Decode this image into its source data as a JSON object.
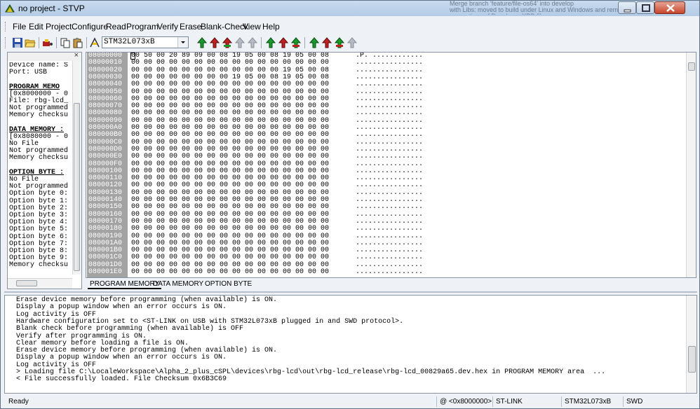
{
  "window": {
    "title": "no project - STVP",
    "background_windows": [
      "Merge branch 'feature/file-os64' into develop",
      "with Libs: moved to build under Linux and Windows and remove generations of Developer XBD files"
    ]
  },
  "menu": [
    "File",
    "Edit",
    "Project",
    "Configure",
    "Read",
    "Program",
    "Verify",
    "Erase",
    "Blank-Check",
    "View",
    "Help"
  ],
  "toolbar": {
    "device": "STM32L073xB",
    "icons": [
      "save-icon",
      "open-folder-icon",
      "connect-icon",
      "copy-icon",
      "paste-icon",
      "ladder-icon",
      "read-all-icon",
      "read-current-icon",
      "read-icon",
      "read-disabled-icon",
      "read-disabled-icon",
      "program-all-icon",
      "program-current-icon",
      "program-icon",
      "verify-all-icon",
      "verify-current-icon",
      "verify-icon",
      "verify-disabled-icon"
    ]
  },
  "info_panel": {
    "lines": [
      {
        "text": "Device name: S",
        "header": false
      },
      {
        "text": "Port: USB",
        "header": false
      },
      {
        "text": "",
        "header": false
      },
      {
        "text": "PROGRAM MEMO",
        "header": true
      },
      {
        "text": "[0x8000000 - 0",
        "header": false
      },
      {
        "text": "File: rbg-lcd_",
        "header": false
      },
      {
        "text": "Not programmed",
        "header": false
      },
      {
        "text": "Memory checksu",
        "header": false
      },
      {
        "text": "",
        "header": false
      },
      {
        "text": "DATA MEMORY :",
        "header": true
      },
      {
        "text": "[0x8080000 - 0",
        "header": false
      },
      {
        "text": "No File",
        "header": false
      },
      {
        "text": "Not programmed",
        "header": false
      },
      {
        "text": "Memory checksu",
        "header": false
      },
      {
        "text": "",
        "header": false
      },
      {
        "text": "OPTION BYTE :",
        "header": true
      },
      {
        "text": "No File",
        "header": false
      },
      {
        "text": "Not programmed",
        "header": false
      },
      {
        "text": "Option byte 0:",
        "header": false
      },
      {
        "text": "Option byte 1:",
        "header": false
      },
      {
        "text": "Option byte 2:",
        "header": false
      },
      {
        "text": "Option byte 3:",
        "header": false
      },
      {
        "text": "Option byte 4:",
        "header": false
      },
      {
        "text": "Option byte 5:",
        "header": false
      },
      {
        "text": "Option byte 6:",
        "header": false
      },
      {
        "text": "Option byte 7:",
        "header": false
      },
      {
        "text": "Option byte 8:",
        "header": false
      },
      {
        "text": "Option byte 9:",
        "header": false
      },
      {
        "text": "Memory checksu",
        "header": false
      }
    ]
  },
  "hex": {
    "rows": [
      {
        "addr": "08000000",
        "bytes": "00 50 00 20 89 09 00 08 19 05 00 08 19 05 00 08",
        "ascii": ".P. ............"
      },
      {
        "addr": "08000010",
        "bytes": "00 00 00 00 00 00 00 00 00 00 00 00 00 00 00 00",
        "ascii": "................"
      },
      {
        "addr": "08000020",
        "bytes": "00 00 00 00 00 00 00 00 00 00 00 00 19 05 00 08",
        "ascii": "................"
      },
      {
        "addr": "08000030",
        "bytes": "00 00 00 00 00 00 00 00 19 05 00 08 19 05 00 08",
        "ascii": "................"
      },
      {
        "addr": "08000040",
        "bytes": "00 00 00 00 00 00 00 00 00 00 00 00 00 00 00 00",
        "ascii": "................"
      },
      {
        "addr": "08000050",
        "bytes": "00 00 00 00 00 00 00 00 00 00 00 00 00 00 00 00",
        "ascii": "................"
      },
      {
        "addr": "08000060",
        "bytes": "00 00 00 00 00 00 00 00 00 00 00 00 00 00 00 00",
        "ascii": "................"
      },
      {
        "addr": "08000070",
        "bytes": "00 00 00 00 00 00 00 00 00 00 00 00 00 00 00 00",
        "ascii": "................"
      },
      {
        "addr": "08000080",
        "bytes": "00 00 00 00 00 00 00 00 00 00 00 00 00 00 00 00",
        "ascii": "................"
      },
      {
        "addr": "08000090",
        "bytes": "00 00 00 00 00 00 00 00 00 00 00 00 00 00 00 00",
        "ascii": "................"
      },
      {
        "addr": "080000A0",
        "bytes": "00 00 00 00 00 00 00 00 00 00 00 00 00 00 00 00",
        "ascii": "................"
      },
      {
        "addr": "080000B0",
        "bytes": "00 00 00 00 00 00 00 00 00 00 00 00 00 00 00 00",
        "ascii": "................"
      },
      {
        "addr": "080000C0",
        "bytes": "00 00 00 00 00 00 00 00 00 00 00 00 00 00 00 00",
        "ascii": "................"
      },
      {
        "addr": "080000D0",
        "bytes": "00 00 00 00 00 00 00 00 00 00 00 00 00 00 00 00",
        "ascii": "................"
      },
      {
        "addr": "080000E0",
        "bytes": "00 00 00 00 00 00 00 00 00 00 00 00 00 00 00 00",
        "ascii": "................"
      },
      {
        "addr": "080000F0",
        "bytes": "00 00 00 00 00 00 00 00 00 00 00 00 00 00 00 00",
        "ascii": "................"
      },
      {
        "addr": "08000100",
        "bytes": "00 00 00 00 00 00 00 00 00 00 00 00 00 00 00 00",
        "ascii": "................"
      },
      {
        "addr": "08000110",
        "bytes": "00 00 00 00 00 00 00 00 00 00 00 00 00 00 00 00",
        "ascii": "................"
      },
      {
        "addr": "08000120",
        "bytes": "00 00 00 00 00 00 00 00 00 00 00 00 00 00 00 00",
        "ascii": "................"
      },
      {
        "addr": "08000130",
        "bytes": "00 00 00 00 00 00 00 00 00 00 00 00 00 00 00 00",
        "ascii": "................"
      },
      {
        "addr": "08000140",
        "bytes": "00 00 00 00 00 00 00 00 00 00 00 00 00 00 00 00",
        "ascii": "................"
      },
      {
        "addr": "08000150",
        "bytes": "00 00 00 00 00 00 00 00 00 00 00 00 00 00 00 00",
        "ascii": "................"
      },
      {
        "addr": "08000160",
        "bytes": "00 00 00 00 00 00 00 00 00 00 00 00 00 00 00 00",
        "ascii": "................"
      },
      {
        "addr": "08000170",
        "bytes": "00 00 00 00 00 00 00 00 00 00 00 00 00 00 00 00",
        "ascii": "................"
      },
      {
        "addr": "08000180",
        "bytes": "00 00 00 00 00 00 00 00 00 00 00 00 00 00 00 00",
        "ascii": "................"
      },
      {
        "addr": "08000190",
        "bytes": "00 00 00 00 00 00 00 00 00 00 00 00 00 00 00 00",
        "ascii": "................"
      },
      {
        "addr": "080001A0",
        "bytes": "00 00 00 00 00 00 00 00 00 00 00 00 00 00 00 00",
        "ascii": "................"
      },
      {
        "addr": "080001B0",
        "bytes": "00 00 00 00 00 00 00 00 00 00 00 00 00 00 00 00",
        "ascii": "................"
      },
      {
        "addr": "080001C0",
        "bytes": "00 00 00 00 00 00 00 00 00 00 00 00 00 00 00 00",
        "ascii": "................"
      },
      {
        "addr": "080001D0",
        "bytes": "00 00 00 00 00 00 00 00 00 00 00 00 00 00 00 00",
        "ascii": "................"
      },
      {
        "addr": "080001E0",
        "bytes": "00 00 00 00 00 00 00 00 00 00 00 00 00 00 00 00",
        "ascii": "................"
      }
    ]
  },
  "tabs": [
    {
      "label": "PROGRAM MEMORY",
      "active": true
    },
    {
      "label": "DATA MEMORY",
      "active": false
    },
    {
      "label": "OPTION BYTE",
      "active": false
    }
  ],
  "log": [
    "Erase device memory before programming (when available) is ON.",
    "Display a popup window when an error occurs is ON.",
    "Log activity is OFF",
    "Hardware configuration set to <ST-LINK on USB with STM32L073xB plugged in and SWD protocol>.",
    "Blank check before programming (when available) is OFF",
    "Verify after programming is ON.",
    "Clear memory before loading a file is ON.",
    "Erase device memory before programming (when available) is ON.",
    "Display a popup window when an error occurs is ON.",
    "Log activity is OFF",
    "> Loading file C:\\LocaleWorkspace\\Alpha_2_plus_cSPL\\devices\\rbg-lcd\\out\\rbg-lcd_release\\rbg-lcd_00829a65.dev.hex in PROGRAM MEMORY area  ...",
    "< File successfully loaded. File Checksum 0x6B3C69"
  ],
  "status": {
    "ready": "Ready",
    "address": "@ <0x8000000>",
    "programmer": "ST-LINK",
    "device": "STM32L073xB",
    "protocol": "SWD"
  },
  "colors": {
    "address_column": "#a3a3a3",
    "title_bar": "#c3d6ec",
    "close_button": "#c7452c"
  }
}
